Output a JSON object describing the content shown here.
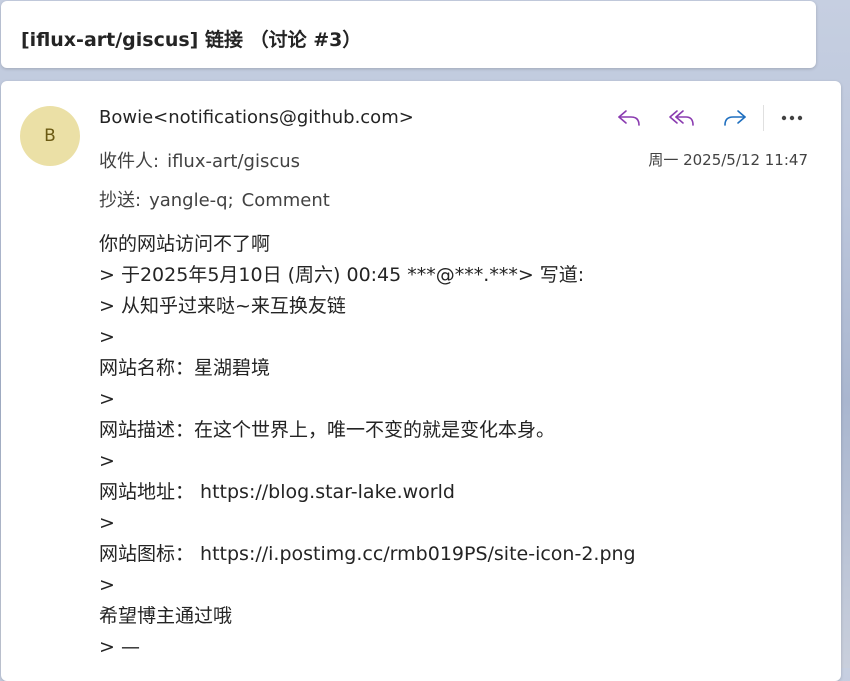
{
  "subject": "[iflux-art/giscus] 链接 （讨论 #3）",
  "message": {
    "avatar_initial": "B",
    "sender": "Bowie<notifications@github.com>",
    "to_label": "收件人:",
    "to_value": "iflux-art/giscus",
    "cc_label": "抄送:",
    "cc_values": [
      "yangle-q;",
      "Comment"
    ],
    "date": "周一 2025/5/12 11:47",
    "actions": [
      {
        "name": "reply",
        "icon": "reply-icon"
      },
      {
        "name": "reply-all",
        "icon": "reply-all-icon"
      },
      {
        "name": "forward",
        "icon": "forward-icon"
      },
      {
        "name": "more",
        "icon": "more-icon"
      }
    ],
    "body_lines": [
      "你的网站访问不了啊",
      "> 于2025年5月10日 (周六) 00:45 ***@***.***> 写道:",
      "> 从知乎过来哒~来互换友链",
      ">",
      "网站名称：星湖碧境",
      ">",
      "网站描述：在这个世界上，唯一不变的就是变化本身。",
      ">",
      "网站地址： https://blog.star-lake.world",
      ">",
      "网站图标： https://i.postimg.cc/rmb019PS/site-icon-2.png",
      ">",
      "希望博主通过哦",
      "> —"
    ]
  },
  "colors": {
    "reply_icon": "#8a3bb0",
    "forward_icon": "#1f6fbf",
    "avatar_bg": "#ebe0a6",
    "avatar_text": "#6b5a13"
  }
}
